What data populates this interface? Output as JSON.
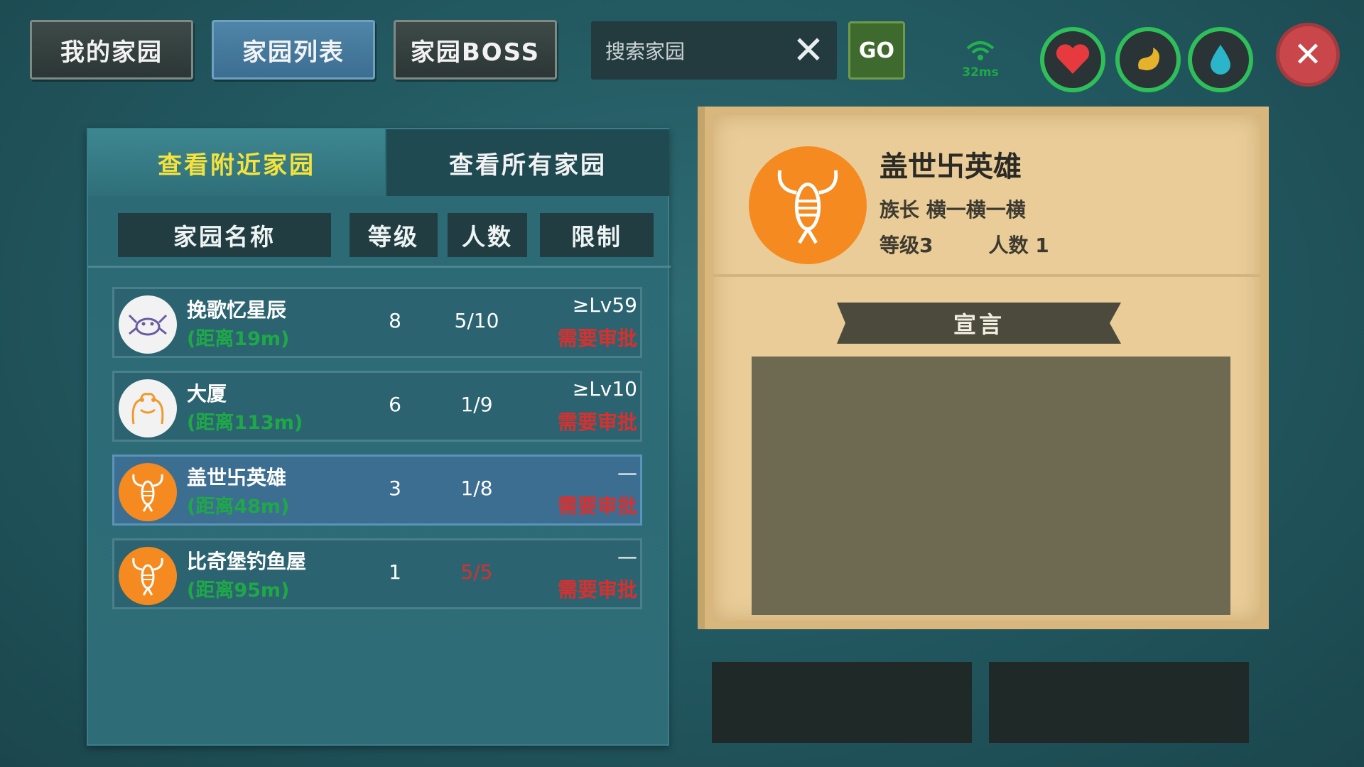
{
  "top_tabs": {
    "my_home": "我的家园",
    "home_list": "家园列表",
    "home_boss": "家园BOSS"
  },
  "search": {
    "placeholder": "搜索家园",
    "go_label": "GO"
  },
  "status": {
    "ping": "32ms"
  },
  "icons": {
    "heart": "heart-icon",
    "food": "food-icon",
    "water": "water-drop-icon",
    "close": "close-icon"
  },
  "colors": {
    "accent_yellow": "#f5e23a",
    "distance_green": "#1fa848",
    "warning_red": "#d8302e",
    "selected_row": "#3c6e92"
  },
  "sub_tabs": {
    "nearby": "查看附近家园",
    "all": "查看所有家园"
  },
  "columns": {
    "name": "家园名称",
    "level": "等级",
    "count": "人数",
    "limit": "限制"
  },
  "homes": [
    {
      "name": "挽歌忆星辰",
      "distance": "(距离19m)",
      "level": "8",
      "count": "5/10",
      "limit": "≥Lv59",
      "approval": "需要审批",
      "avatar": "crab-icon"
    },
    {
      "name": "大厦",
      "distance": "(距离113m)",
      "level": "6",
      "count": "1/9",
      "limit": "≥Lv10",
      "approval": "需要审批",
      "avatar": "frog-icon"
    },
    {
      "name": "盖世卐英雄",
      "distance": "(距离48m)",
      "level": "3",
      "count": "1/8",
      "limit": "—",
      "approval": "需要审批",
      "avatar": "lobster-icon"
    },
    {
      "name": "比奇堡钓鱼屋",
      "distance": "(距离95m)",
      "level": "1",
      "count": "5/5",
      "limit": "—",
      "approval": "需要审批",
      "avatar": "lobster-icon"
    }
  ],
  "detail": {
    "name": "盖世卐英雄",
    "leader": "族长  横一横一横",
    "stats": "等级3        人数 1",
    "declaration_title": "宣言",
    "declaration_text": ""
  }
}
